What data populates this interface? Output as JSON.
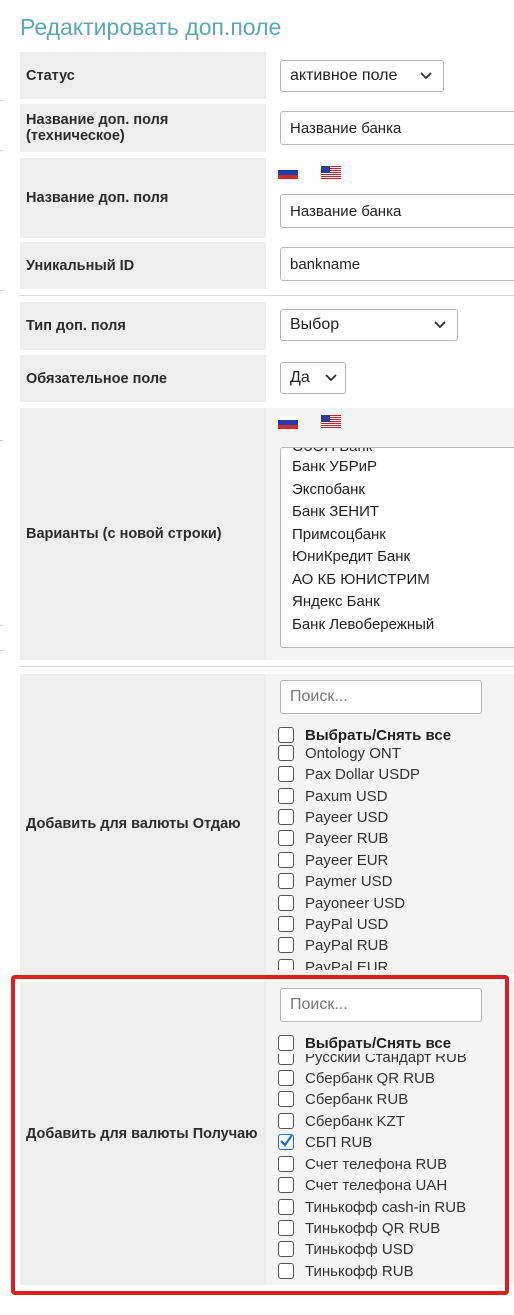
{
  "page": {
    "title": "Редактировать доп.поле"
  },
  "fields": {
    "status": {
      "label": "Статус",
      "value": "активное поле"
    },
    "tech_name": {
      "label": "Название доп. поля (техническое)",
      "value": "Название банка"
    },
    "name": {
      "label": "Название доп. поля",
      "value": "Название банка"
    },
    "unique_id": {
      "label": "Уникальный ID",
      "value": "bankname"
    },
    "field_type": {
      "label": "Тип доп. поля",
      "value": "Выбор"
    },
    "required": {
      "label": "Обязательное поле",
      "value": "Да"
    },
    "variants": {
      "label": "Варианты (с новой строки)",
      "partial_top": "ОЗОН Банк",
      "lines": [
        "Банк УБРиР",
        "Экспобанк",
        "Банк ЗЕНИТ",
        "Примсоцбанк",
        "ЮниКредит Банк",
        "АО КБ ЮНИСТРИМ",
        "Яндекс Банк",
        "Банк Левобережный"
      ]
    },
    "give_currencies": {
      "label": "Добавить для валюты Отдаю",
      "search_placeholder": "Поиск...",
      "select_all": "Выбрать/Снять все",
      "items": [
        {
          "name": "Ontology ONT",
          "checked": false
        },
        {
          "name": "Pax Dollar USDP",
          "checked": false
        },
        {
          "name": "Paxum USD",
          "checked": false
        },
        {
          "name": "Payeer USD",
          "checked": false
        },
        {
          "name": "Payeer RUB",
          "checked": false
        },
        {
          "name": "Payeer EUR",
          "checked": false
        },
        {
          "name": "Paymer USD",
          "checked": false
        },
        {
          "name": "Payoneer USD",
          "checked": false
        },
        {
          "name": "PayPal USD",
          "checked": false
        },
        {
          "name": "PayPal RUB",
          "checked": false
        },
        {
          "name": "PayPal EUR",
          "checked": false
        }
      ]
    },
    "get_currencies": {
      "label": "Добавить для валюты Получаю",
      "search_placeholder": "Поиск...",
      "select_all": "Выбрать/Снять все",
      "items": [
        {
          "name": "Русский Стандарт RUB",
          "checked": false
        },
        {
          "name": "Сбербанк QR RUB",
          "checked": false
        },
        {
          "name": "Сбербанк RUB",
          "checked": false
        },
        {
          "name": "Сбербанк KZT",
          "checked": false
        },
        {
          "name": "СБП RUB",
          "checked": true
        },
        {
          "name": "Счет телефона RUB",
          "checked": false
        },
        {
          "name": "Счет телефона UAH",
          "checked": false
        },
        {
          "name": "Тинькофф cash-in RUB",
          "checked": false
        },
        {
          "name": "Тинькофф QR RUB",
          "checked": false
        },
        {
          "name": "Тинькофф USD",
          "checked": false
        },
        {
          "name": "Тинькофф RUB",
          "checked": false
        }
      ]
    }
  },
  "icons": {
    "flag_ru": "russian-flag-icon",
    "flag_us": "us-flag-icon",
    "dropdown": "chevron-down-icon",
    "check": "checkmark-icon"
  },
  "colors": {
    "title": "#5aa8b3",
    "highlight": "#e01e1e",
    "label_bg": "#eeeeee",
    "check": "#1f6fd1"
  }
}
